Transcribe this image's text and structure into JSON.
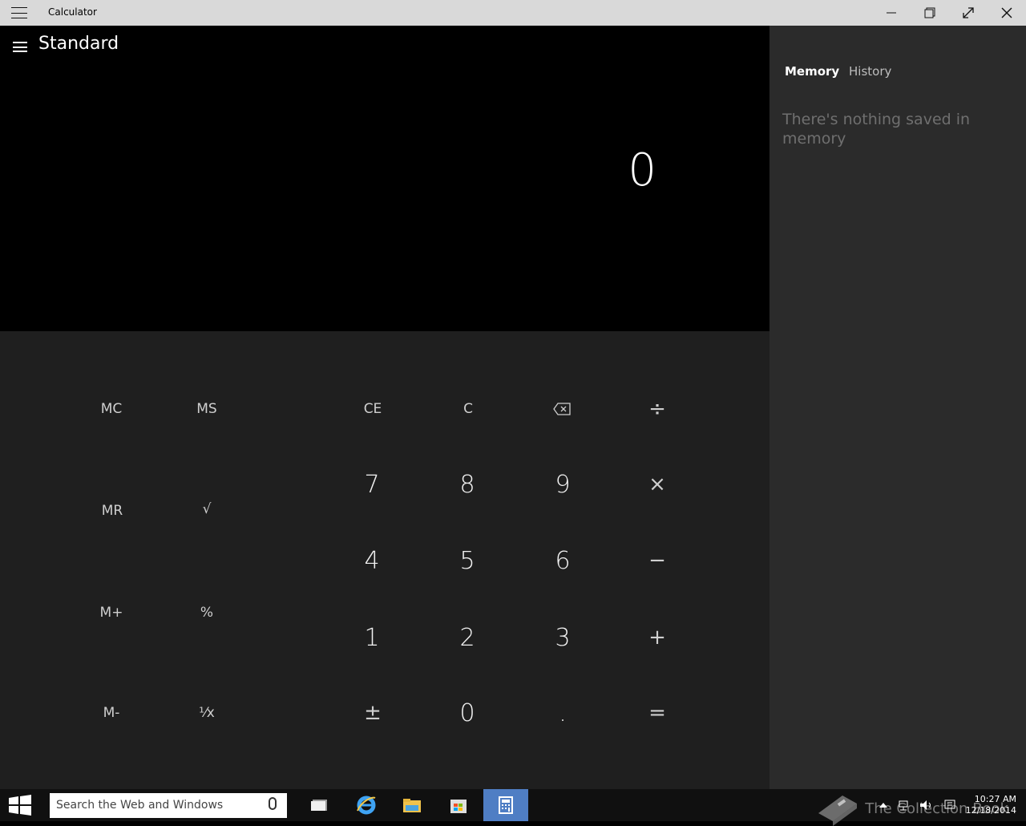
{
  "window": {
    "title": "Calculator"
  },
  "calculator": {
    "mode_title": "Standard",
    "display_value": "0",
    "memory_keys": {
      "mc": "MC",
      "ms": "MS",
      "mr": "MR",
      "sqrt": "√",
      "m_plus": "M+",
      "percent": "%",
      "m_minus": "M-",
      "reciprocal": "¹⁄x"
    },
    "function_keys": {
      "ce": "CE",
      "c": "C",
      "divide": "÷",
      "multiply": "×",
      "subtract": "−",
      "add": "+",
      "equals": "=",
      "negate": "±",
      "decimal": "."
    },
    "digits": {
      "0": "0",
      "1": "1",
      "2": "2",
      "3": "3",
      "4": "4",
      "5": "5",
      "6": "6",
      "7": "7",
      "8": "8",
      "9": "9"
    }
  },
  "panel": {
    "tabs": [
      {
        "label": "Memory",
        "active": true
      },
      {
        "label": "History",
        "active": false
      }
    ],
    "empty_message": "There's nothing saved in memory"
  },
  "taskbar": {
    "search_placeholder": "Search the Web and Windows",
    "time": "10:27 AM",
    "date": "12/18/2014",
    "watermark": "The Collection Book"
  }
}
